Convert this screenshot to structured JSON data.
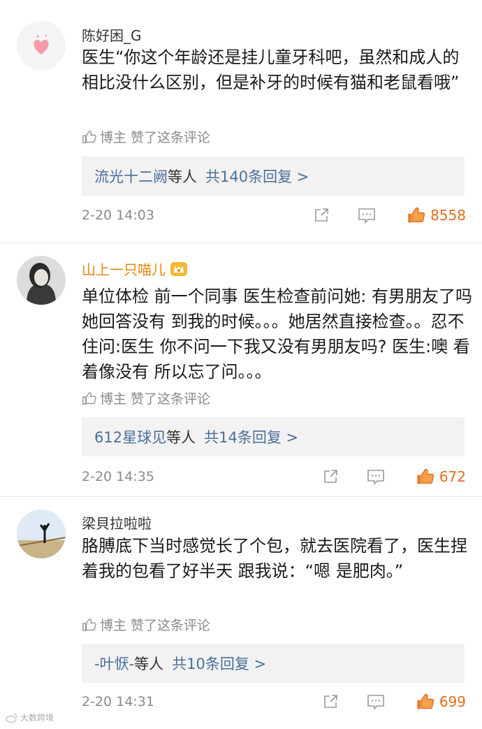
{
  "comments": [
    {
      "username": "陈好困_G",
      "text": "医生“你这个年龄还是挂儿童牙科吧，虽然和成人的相比没什么区别，但是补牙的时候有猫和老鼠看哦”",
      "liked_by": "博主 赞了这条评论",
      "reply_user": "流光十二阙",
      "reply_suffix": "等人",
      "reply_count": "共140条回复 >",
      "timestamp": "2-20 14:03",
      "likes": "8558",
      "avatar_icon": "heart-icon"
    },
    {
      "username": "山上一只喵儿",
      "text": "单位体检 前一个同事 医生检查前问她: 有男朋友了吗 她回答没有 到我的时候。。。她居然直接检查。。忍不住问:医生 你不问一下我又没有男朋友吗? 医生:噢 看着像没有 所以忘了问。。。",
      "liked_by": "博主 赞了这条评论",
      "reply_user": "612星球见",
      "reply_suffix": "等人",
      "reply_count": "共14条回复 >",
      "timestamp": "2-20 14:35",
      "likes": "672",
      "avatar_icon": "user-photo-icon"
    },
    {
      "username": "梁貝拉啦啦",
      "text": "胳膊底下当时感觉长了个包，就去医院看了，医生捏着我的包看了好半天 跟我说：“嗯 是肥肉。”",
      "liked_by": "博主 赞了这条评论",
      "reply_user": "-叶恹-",
      "reply_suffix": "等人",
      "reply_count": "共10条回复 >",
      "timestamp": "2-20 14:31",
      "likes": "699",
      "avatar_icon": "landscape-photo-icon"
    }
  ],
  "watermark": "大数跨境",
  "colors": {
    "link_blue": "#4a6f9a",
    "like_orange": "#e56c1e",
    "gray_text": "#8a8a8a",
    "gold_name": "#e8860c"
  }
}
